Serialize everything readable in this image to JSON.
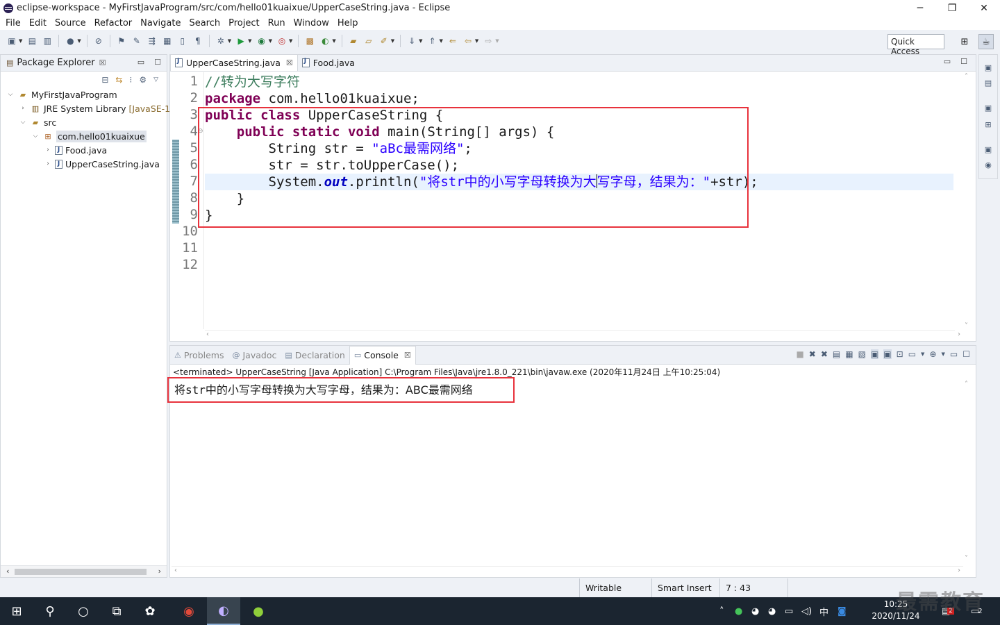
{
  "window": {
    "title": "eclipse-workspace - MyFirstJavaProgram/src/com/hello01kuaixue/UpperCaseString.java - Eclipse",
    "minimize": "─",
    "maximize": "❐",
    "close": "✕"
  },
  "menu": [
    "File",
    "Edit",
    "Source",
    "Refactor",
    "Navigate",
    "Search",
    "Project",
    "Run",
    "Window",
    "Help"
  ],
  "toolbar": {
    "quick_access": "Quick Access"
  },
  "package_explorer": {
    "title": "Package Explorer",
    "close": "☒",
    "tree": [
      {
        "label": "MyFirstJavaProgram",
        "decor": "",
        "twisty": "⌵",
        "icon": "project-icon",
        "glyph": "📁"
      },
      {
        "label": "JRE System Library",
        "decor": "[JavaSE-1.",
        "twisty": "›",
        "icon": "library-icon",
        "glyph": "▤"
      },
      {
        "label": "src",
        "decor": "",
        "twisty": "⌵",
        "icon": "source-folder-icon",
        "glyph": "📂"
      },
      {
        "label": "com.hello01kuaixue",
        "decor": "",
        "twisty": "⌵",
        "icon": "package-icon",
        "glyph": "⊞"
      },
      {
        "label": "Food.java",
        "decor": "",
        "twisty": "›",
        "icon": "java-file-icon",
        "glyph": "J"
      },
      {
        "label": "UpperCaseString.java",
        "decor": "",
        "twisty": "›",
        "icon": "java-file-icon",
        "glyph": "J"
      }
    ]
  },
  "editor": {
    "tabs": [
      {
        "label": "UpperCaseString.java",
        "close": "☒"
      },
      {
        "label": "Food.java",
        "close": ""
      }
    ],
    "line_numbers": [
      "1",
      "2",
      "3",
      "4",
      "5",
      "6",
      "7",
      "8",
      "9",
      "10",
      "11",
      "12"
    ],
    "code": {
      "l1_comment": "//转为大写字符",
      "l2_kw": "package",
      "l2_rest": " com.hello01kuaixue;",
      "l3_kw1": "public",
      "l3_kw2": "class",
      "l3_rest": " UpperCaseString {",
      "l4_indent": "    ",
      "l4_kw1": "public",
      "l4_kw2": "static",
      "l4_kw3": "void",
      "l4_rest": " main(String[] args) {",
      "l5_pre": "        String str = ",
      "l5_str": "\"aBc最需网络\"",
      "l5_post": ";",
      "l6": "        str = str.toUpperCase();",
      "l7_pre": "        System.",
      "l7_field": "out",
      "l7_mid": ".println(",
      "l7_str_a": "\"将str中的小写字母转换为大",
      "l7_str_b": "写字母，结果为：\"",
      "l7_post": "+str);",
      "l8": "    }",
      "l9": "}"
    }
  },
  "console": {
    "tabs": [
      {
        "label": "Problems",
        "icon": "problems-icon",
        "glyph": "⚠"
      },
      {
        "label": "Javadoc",
        "icon": "javadoc-icon",
        "glyph": "@"
      },
      {
        "label": "Declaration",
        "icon": "declaration-icon",
        "glyph": "▤"
      },
      {
        "label": "Console",
        "icon": "console-icon",
        "glyph": "▭"
      }
    ],
    "close": "☒",
    "status": "<terminated> UpperCaseString [Java Application] C:\\Program Files\\Java\\jre1.8.0_221\\bin\\javaw.exe (2020年11月24日 上午10:25:04)",
    "output_a": "将",
    "output_b": "str",
    "output_c": "中的小写字母转换为大写字母，结果为：ABC最需网络"
  },
  "statusbar": {
    "writable": "Writable",
    "insert_mode": "Smart Insert",
    "position": "7 : 43"
  },
  "taskbar": {
    "time": "10:25",
    "date": "2020/11/24",
    "ime": "中",
    "notification_count": "2",
    "badge": "2"
  },
  "watermark": "最需教育",
  "colors": {
    "keyword": "#7f0055",
    "string": "#2a00ff",
    "comment": "#3f7f5f",
    "highlight_box": "#e8323c",
    "current_line": "#e8f2fe"
  }
}
